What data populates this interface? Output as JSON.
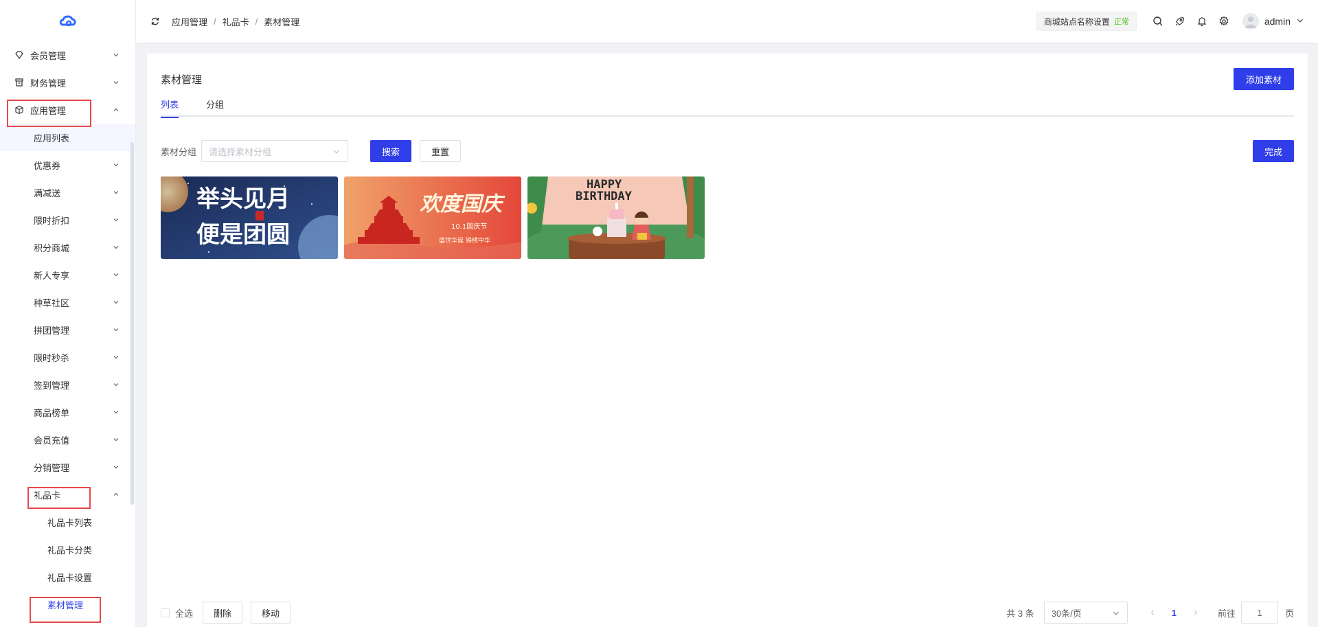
{
  "sidebar": {
    "items": [
      {
        "label": "会员管理"
      },
      {
        "label": "财务管理"
      },
      {
        "label": "应用管理"
      },
      {
        "label": "应用列表"
      },
      {
        "label": "优惠券"
      },
      {
        "label": "满减送"
      },
      {
        "label": "限时折扣"
      },
      {
        "label": "积分商城"
      },
      {
        "label": "新人专享"
      },
      {
        "label": "种草社区"
      },
      {
        "label": "拼团管理"
      },
      {
        "label": "限时秒杀"
      },
      {
        "label": "签到管理"
      },
      {
        "label": "商品榜单"
      },
      {
        "label": "会员充值"
      },
      {
        "label": "分销管理"
      },
      {
        "label": "礼品卡"
      },
      {
        "label": "礼品卡列表"
      },
      {
        "label": "礼品卡分类"
      },
      {
        "label": "礼品卡设置"
      },
      {
        "label": "素材管理"
      }
    ]
  },
  "header": {
    "breadcrumb": [
      "应用管理",
      "礼品卡",
      "素材管理"
    ],
    "breadcrumb_sep": "/",
    "site_name": "商城站点名称设置",
    "site_status": "正常",
    "username": "admin"
  },
  "main": {
    "title": "素材管理",
    "add_button": "添加素材",
    "tabs": [
      {
        "label": "列表"
      },
      {
        "label": "分组"
      }
    ],
    "filter": {
      "label": "素材分组",
      "placeholder": "请选择素材分组",
      "search_button": "搜索",
      "reset_button": "重置",
      "done_button": "完成"
    },
    "materials": [
      {
        "lines": [
          "举头见月",
          "便是团圆"
        ]
      },
      {
        "title": "欢度国庆",
        "subtitle": "10.1国庆节",
        "caption": "盛世华诞  锦绣中华"
      },
      {
        "title_line1": "HAPPY",
        "title_line2": "BIRTHDAY"
      }
    ],
    "footer": {
      "select_all": "全选",
      "delete_button": "删除",
      "move_button": "移动",
      "total": "共 3 条",
      "page_size": "30条/页",
      "current_page": "1",
      "goto_label": "前往",
      "goto_value": "1",
      "page_unit": "页"
    }
  },
  "colors": {
    "primary": "#2f3ee8",
    "highlight": "#e8484c",
    "status_ok": "#52c41a"
  }
}
